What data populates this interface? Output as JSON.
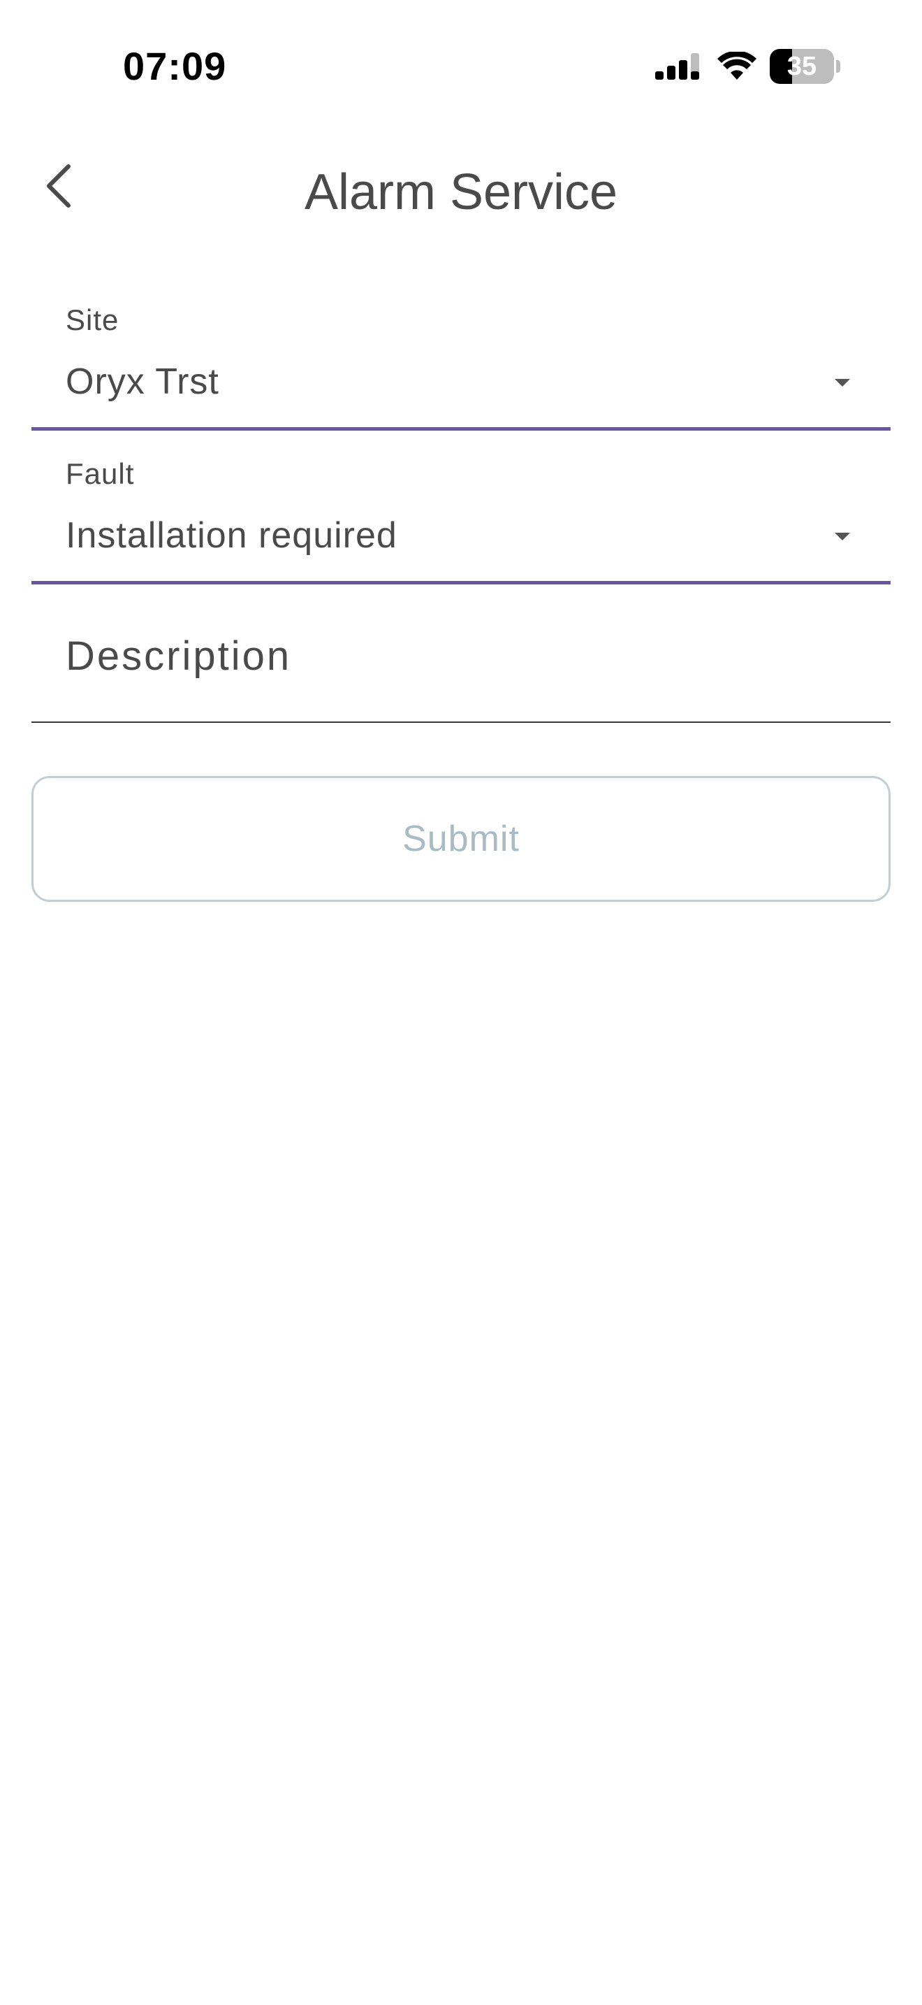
{
  "status_bar": {
    "time": "07:09",
    "battery_level": "35",
    "battery_fraction": 0.35,
    "signal_icon": "cellular-signal-icon",
    "wifi_icon": "wifi-icon",
    "battery_icon": "battery-icon"
  },
  "header": {
    "title": "Alarm Service",
    "back_icon": "chevron-left-icon"
  },
  "form": {
    "site": {
      "label": "Site",
      "value": "Oryx Trst",
      "icon": "dropdown-arrow-icon"
    },
    "fault": {
      "label": "Fault",
      "value": "Installation required",
      "icon": "dropdown-arrow-icon"
    },
    "description": {
      "placeholder": "Description",
      "value": ""
    },
    "submit_label": "Submit"
  },
  "colors": {
    "accent": "#6a55a3",
    "text": "#4a4a4a",
    "button_border": "#c3ced3",
    "button_text_disabled": "#a9bcc4"
  }
}
